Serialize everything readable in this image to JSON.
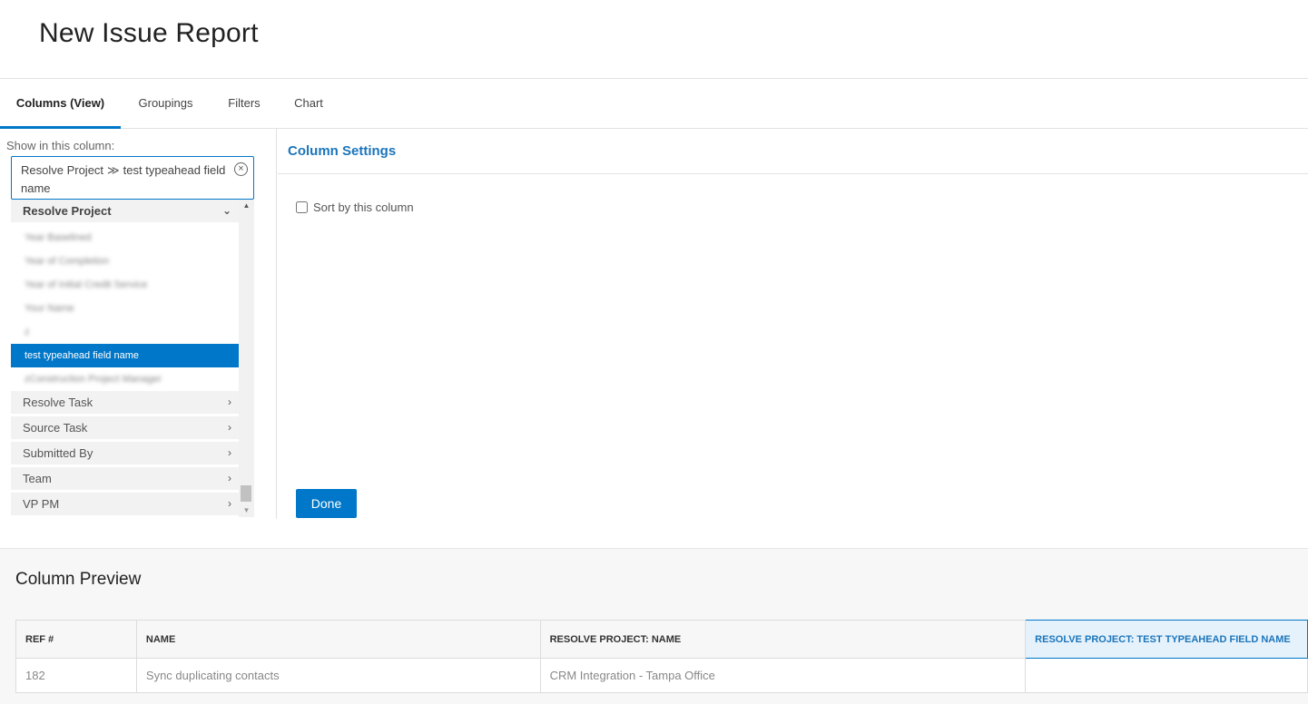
{
  "page": {
    "title": "New Issue Report"
  },
  "tabs": [
    {
      "label": "Columns (View)",
      "active": true
    },
    {
      "label": "Groupings",
      "active": false
    },
    {
      "label": "Filters",
      "active": false
    },
    {
      "label": "Chart",
      "active": false
    }
  ],
  "left_panel": {
    "show_label": "Show in this column:",
    "picker": {
      "path_part1": "Resolve Project",
      "separator": "≫",
      "path_part2": "test typeahead field name",
      "clear_icon": "circle-x-icon"
    },
    "tree": {
      "expanded_group": {
        "label": "Resolve Project",
        "icon": "chevron-down-icon"
      },
      "leaves": [
        {
          "label": "Year Baselined",
          "blurred": true
        },
        {
          "label": "Year of Completion",
          "blurred": true
        },
        {
          "label": "Year of Initial Credit Service",
          "blurred": true
        },
        {
          "label": "Your Name",
          "blurred": true
        },
        {
          "label": "z",
          "blurred": true
        },
        {
          "label": "test typeahead field name",
          "selected": true
        },
        {
          "label": "zConstruction Project Manager",
          "blurred": true
        }
      ],
      "groups": [
        {
          "label": "Resolve Task",
          "icon": "chevron-right-icon"
        },
        {
          "label": "Source Task",
          "icon": "chevron-right-icon"
        },
        {
          "label": "Submitted By",
          "icon": "chevron-right-icon"
        },
        {
          "label": "Team",
          "icon": "chevron-right-icon"
        },
        {
          "label": "VP PM",
          "icon": "chevron-right-icon"
        }
      ]
    }
  },
  "settings": {
    "title": "Column Settings",
    "sort_label": "Sort by this column",
    "sort_checked": false,
    "done_label": "Done"
  },
  "preview": {
    "title": "Column Preview",
    "headers": [
      "REF #",
      "NAME",
      "RESOLVE PROJECT: NAME",
      "RESOLVE PROJECT: TEST TYPEAHEAD FIELD NAME"
    ],
    "rows": [
      [
        "182",
        "Sync duplicating contacts",
        "CRM Integration - Tampa Office",
        ""
      ]
    ]
  },
  "colors": {
    "accent": "#0077c8",
    "heading_blue": "#1b75bb"
  }
}
